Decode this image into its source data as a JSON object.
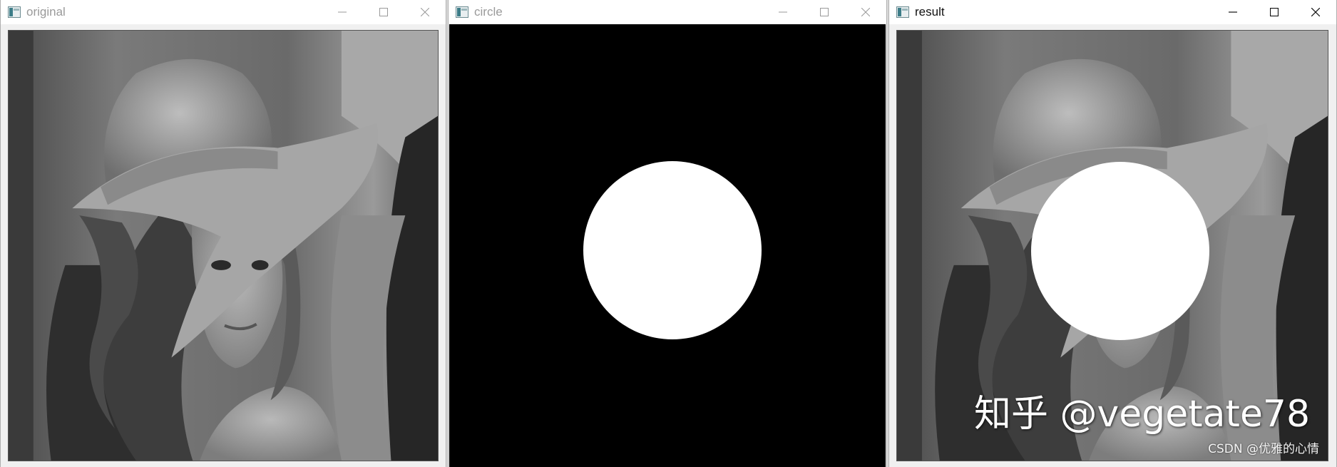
{
  "windows": [
    {
      "title": "original",
      "icon": "opencv-window-icon",
      "title_active": false
    },
    {
      "title": "circle",
      "icon": "opencv-window-icon",
      "title_active": false
    },
    {
      "title": "result",
      "icon": "opencv-window-icon",
      "title_active": true
    }
  ],
  "controls": {
    "minimize": "minimize-icon",
    "maximize": "maximize-icon",
    "close": "close-icon"
  },
  "watermarks": {
    "zhihu": "知乎 @vegetate78",
    "csdn": "CSDN @优雅的心情"
  },
  "colors": {
    "mask_background": "#000000",
    "mask_circle": "#ffffff",
    "titlebar": "#ffffff",
    "inactive_title": "#9a9a9a",
    "active_title": "#111111"
  }
}
